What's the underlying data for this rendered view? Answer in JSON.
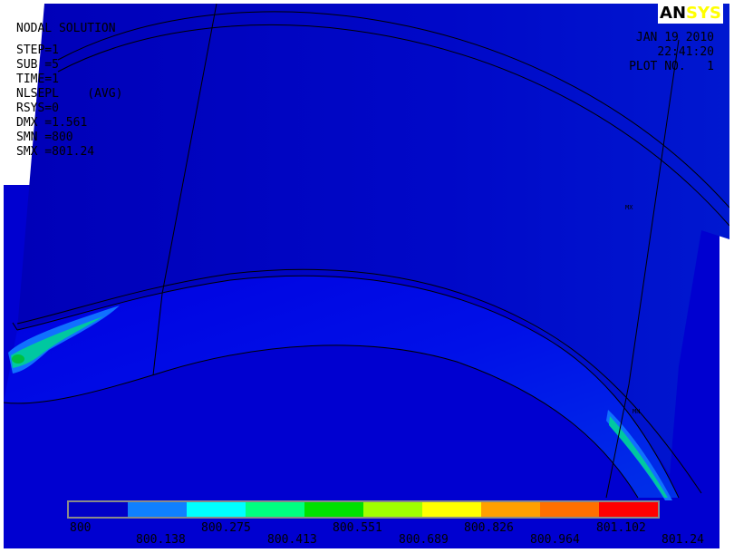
{
  "info": {
    "lines": [
      "NODAL SOLUTION",
      "STEP=1",
      "SUB =5",
      "TIME=1",
      "NLSEPL    (AVG)",
      "RSYS=0",
      "DMX =1.561",
      "SMN =800",
      "SMX =801.24"
    ]
  },
  "logo": {
    "part1": "AN",
    "part2": "SYS"
  },
  "datetime": {
    "date": "JAN 19 2010",
    "time": "22:41:20",
    "plot": "PLOT NO.   1"
  },
  "markers": {
    "mx": "MX",
    "mn": "MN"
  },
  "legend": {
    "colors": [
      "#0000c8",
      "#0f80ff",
      "#00ffff",
      "#00ff80",
      "#00e000",
      "#a0ff00",
      "#ffff00",
      "#ffa000",
      "#ff7000",
      "#ff0000"
    ],
    "labels_top": [
      "800",
      "800.275",
      "800.551",
      "800.826",
      "801.102"
    ],
    "labels_bottom": [
      "800.138",
      "800.413",
      "800.689",
      "800.964",
      "801.24"
    ]
  }
}
